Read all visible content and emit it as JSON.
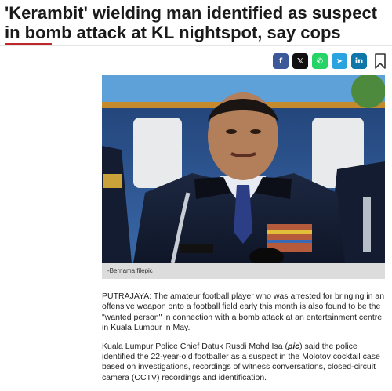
{
  "article": {
    "headline": "'Kerambit' wielding man identified as suspect in bomb attack at KL nightspot, say cops",
    "share": {
      "facebook": "f",
      "x": "𝕏",
      "whatsapp": "✆",
      "telegram": "➤",
      "linkedin": "in"
    },
    "image_caption": "-Bernama filepic",
    "paragraph_1": "PUTRAJAYA: The amateur football player who was arrested for bringing in an offensive weapon onto a football field early this month is also found to be the \"wanted person\" in connection with a bomb attack at an entertainment centre in Kuala Lumpur in May.",
    "paragraph_2": {
      "before": "Kuala Lumpur Police Chief Datuk Rusdi Mohd Isa (",
      "italic": "pic",
      "after": ") said the police identified the 22-year-old footballer as a suspect in the Molotov cocktail case based on investigations, recordings of witness conversations, closed-circuit camera (CCTV) recordings and identification."
    }
  },
  "colors": {
    "accent": "#c0272d",
    "facebook": "#3b5998",
    "x": "#111111",
    "whatsapp": "#25d366",
    "telegram": "#2aa3df",
    "linkedin": "#0e76a8"
  }
}
